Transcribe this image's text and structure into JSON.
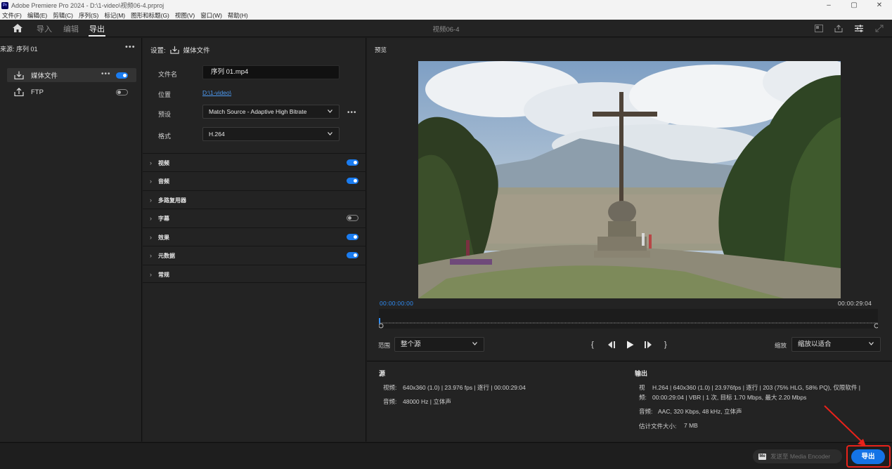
{
  "window": {
    "app_icon": "Pr",
    "title": "Adobe Premiere Pro 2024 - D:\\1-video\\视频06-4.prproj",
    "controls": [
      "–",
      "▢",
      "✕"
    ]
  },
  "menu": [
    "文件(F)",
    "编辑(E)",
    "剪辑(C)",
    "序列(S)",
    "标记(M)",
    "图形和标题(G)",
    "视图(V)",
    "窗口(W)",
    "帮助(H)"
  ],
  "workspace": {
    "tabs": [
      "导入",
      "编辑",
      "导出"
    ],
    "active_tab": "导出",
    "title": "视频06-4"
  },
  "source_panel": {
    "heading": "来源:  序列 01",
    "more": "•••",
    "destinations": [
      {
        "label": "媒体文件",
        "enabled": true,
        "more": "•••"
      },
      {
        "label": "FTP",
        "enabled": false
      }
    ]
  },
  "settings_panel": {
    "heading": "设置:",
    "heading_target": "媒体文件",
    "filename_label": "文件名",
    "filename_value": "序列 01.mp4",
    "location_label": "位置",
    "location_value": "D:\\1-video\\",
    "preset_label": "预设",
    "preset_value": "Match Source - Adaptive High Bitrate",
    "preset_more": "•••",
    "format_label": "格式",
    "format_value": "H.264",
    "sections": [
      {
        "name": "视频",
        "toggle": "on"
      },
      {
        "name": "音频",
        "toggle": "on"
      },
      {
        "name": "多路复用器",
        "toggle": "none"
      },
      {
        "name": "字幕",
        "toggle": "off"
      },
      {
        "name": "效果",
        "toggle": "on"
      },
      {
        "name": "元数据",
        "toggle": "on"
      },
      {
        "name": "常规",
        "toggle": "none"
      }
    ]
  },
  "preview_panel": {
    "heading": "预览",
    "timecode_start": "00:00:00:00",
    "timecode_end": "00:00:29:04",
    "playhead_fraction": 0,
    "range_label": "范围",
    "range_value": "整个源",
    "zoom_label": "缩放",
    "zoom_value": "缩放以适合",
    "transport": {
      "mark_in": "{",
      "step_back": "◀|",
      "play": "▶",
      "step_forward": "|▶",
      "mark_out": "}"
    }
  },
  "info": {
    "source_title": "源",
    "source_video_label": "视频:",
    "source_video": "640x360 (1.0) | 23.976 fps | 逐行 | 00:00:29:04",
    "source_audio_label": "音频:",
    "source_audio": "48000 Hz | 立体声",
    "output_title": "输出",
    "output_video_label_1": "视",
    "output_video_label_2": "频:",
    "output_video_1": "H.264 | 640x360 (1.0) | 23.976fps | 逐行 | 203 (75% HLG, 58% PQ), 仅限软件 |",
    "output_video_2": "00:00:29:04 | VBR | 1 次, 目标 1.70 Mbps, 最大 2.20 Mbps",
    "output_audio_label": "音频:",
    "output_audio": "AAC, 320 Kbps, 48 kHz, 立体声",
    "filesize_label": "估计文件大小:",
    "filesize": "7 MB"
  },
  "footer": {
    "media_encoder_logo": "Me",
    "media_encoder_label": "发送至 Media Encoder",
    "export_label": "导出",
    "export_color": "#1473e6",
    "highlight_color": "#e8221a"
  }
}
